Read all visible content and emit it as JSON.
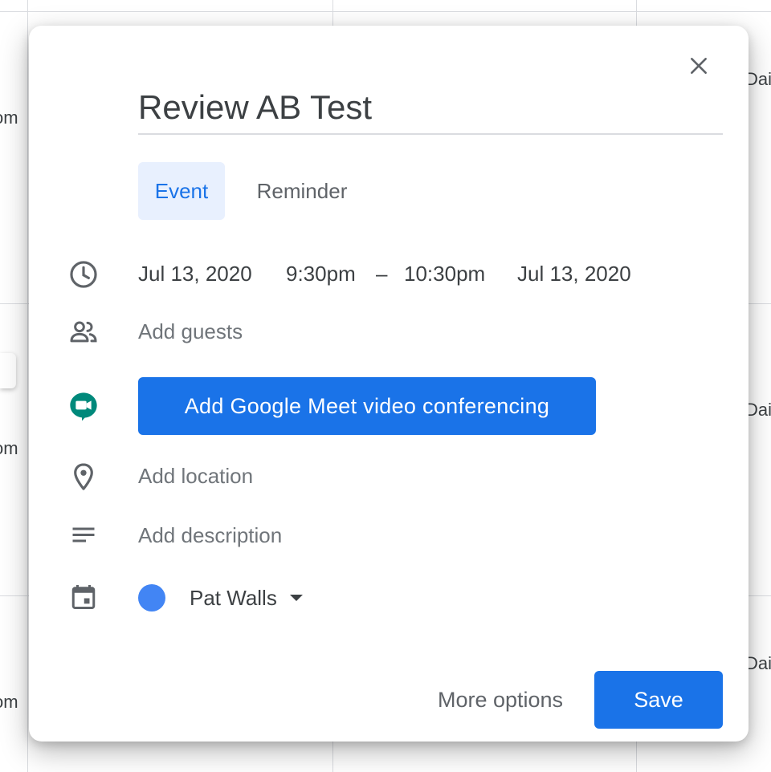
{
  "background": {
    "partial_left_label": "om",
    "partial_right_label": "Dai"
  },
  "dialog": {
    "title": "Review AB Test",
    "tabs": [
      {
        "label": "Event",
        "active": true
      },
      {
        "label": "Reminder",
        "active": false
      }
    ],
    "datetime": {
      "start_date": "Jul 13, 2020",
      "start_time": "9:30pm",
      "separator": "–",
      "end_time": "10:30pm",
      "end_date": "Jul 13, 2020"
    },
    "guests_placeholder": "Add guests",
    "meet_button_label": "Add Google Meet video conferencing",
    "location_placeholder": "Add location",
    "description_placeholder": "Add description",
    "calendar": {
      "owner": "Pat Walls",
      "color": "#4285f4"
    },
    "footer": {
      "more_options_label": "More options",
      "save_label": "Save"
    }
  },
  "icons": {
    "close": "close-icon",
    "time": "clock-icon",
    "guests": "people-icon",
    "meet": "google-meet-icon",
    "location": "location-pin-icon",
    "description": "description-lines-icon",
    "calendar": "calendar-icon"
  },
  "colors": {
    "accent": "#1a73e8",
    "tab_active_bg": "#e8f0fe",
    "placeholder": "#70757a",
    "text": "#3c4043"
  }
}
